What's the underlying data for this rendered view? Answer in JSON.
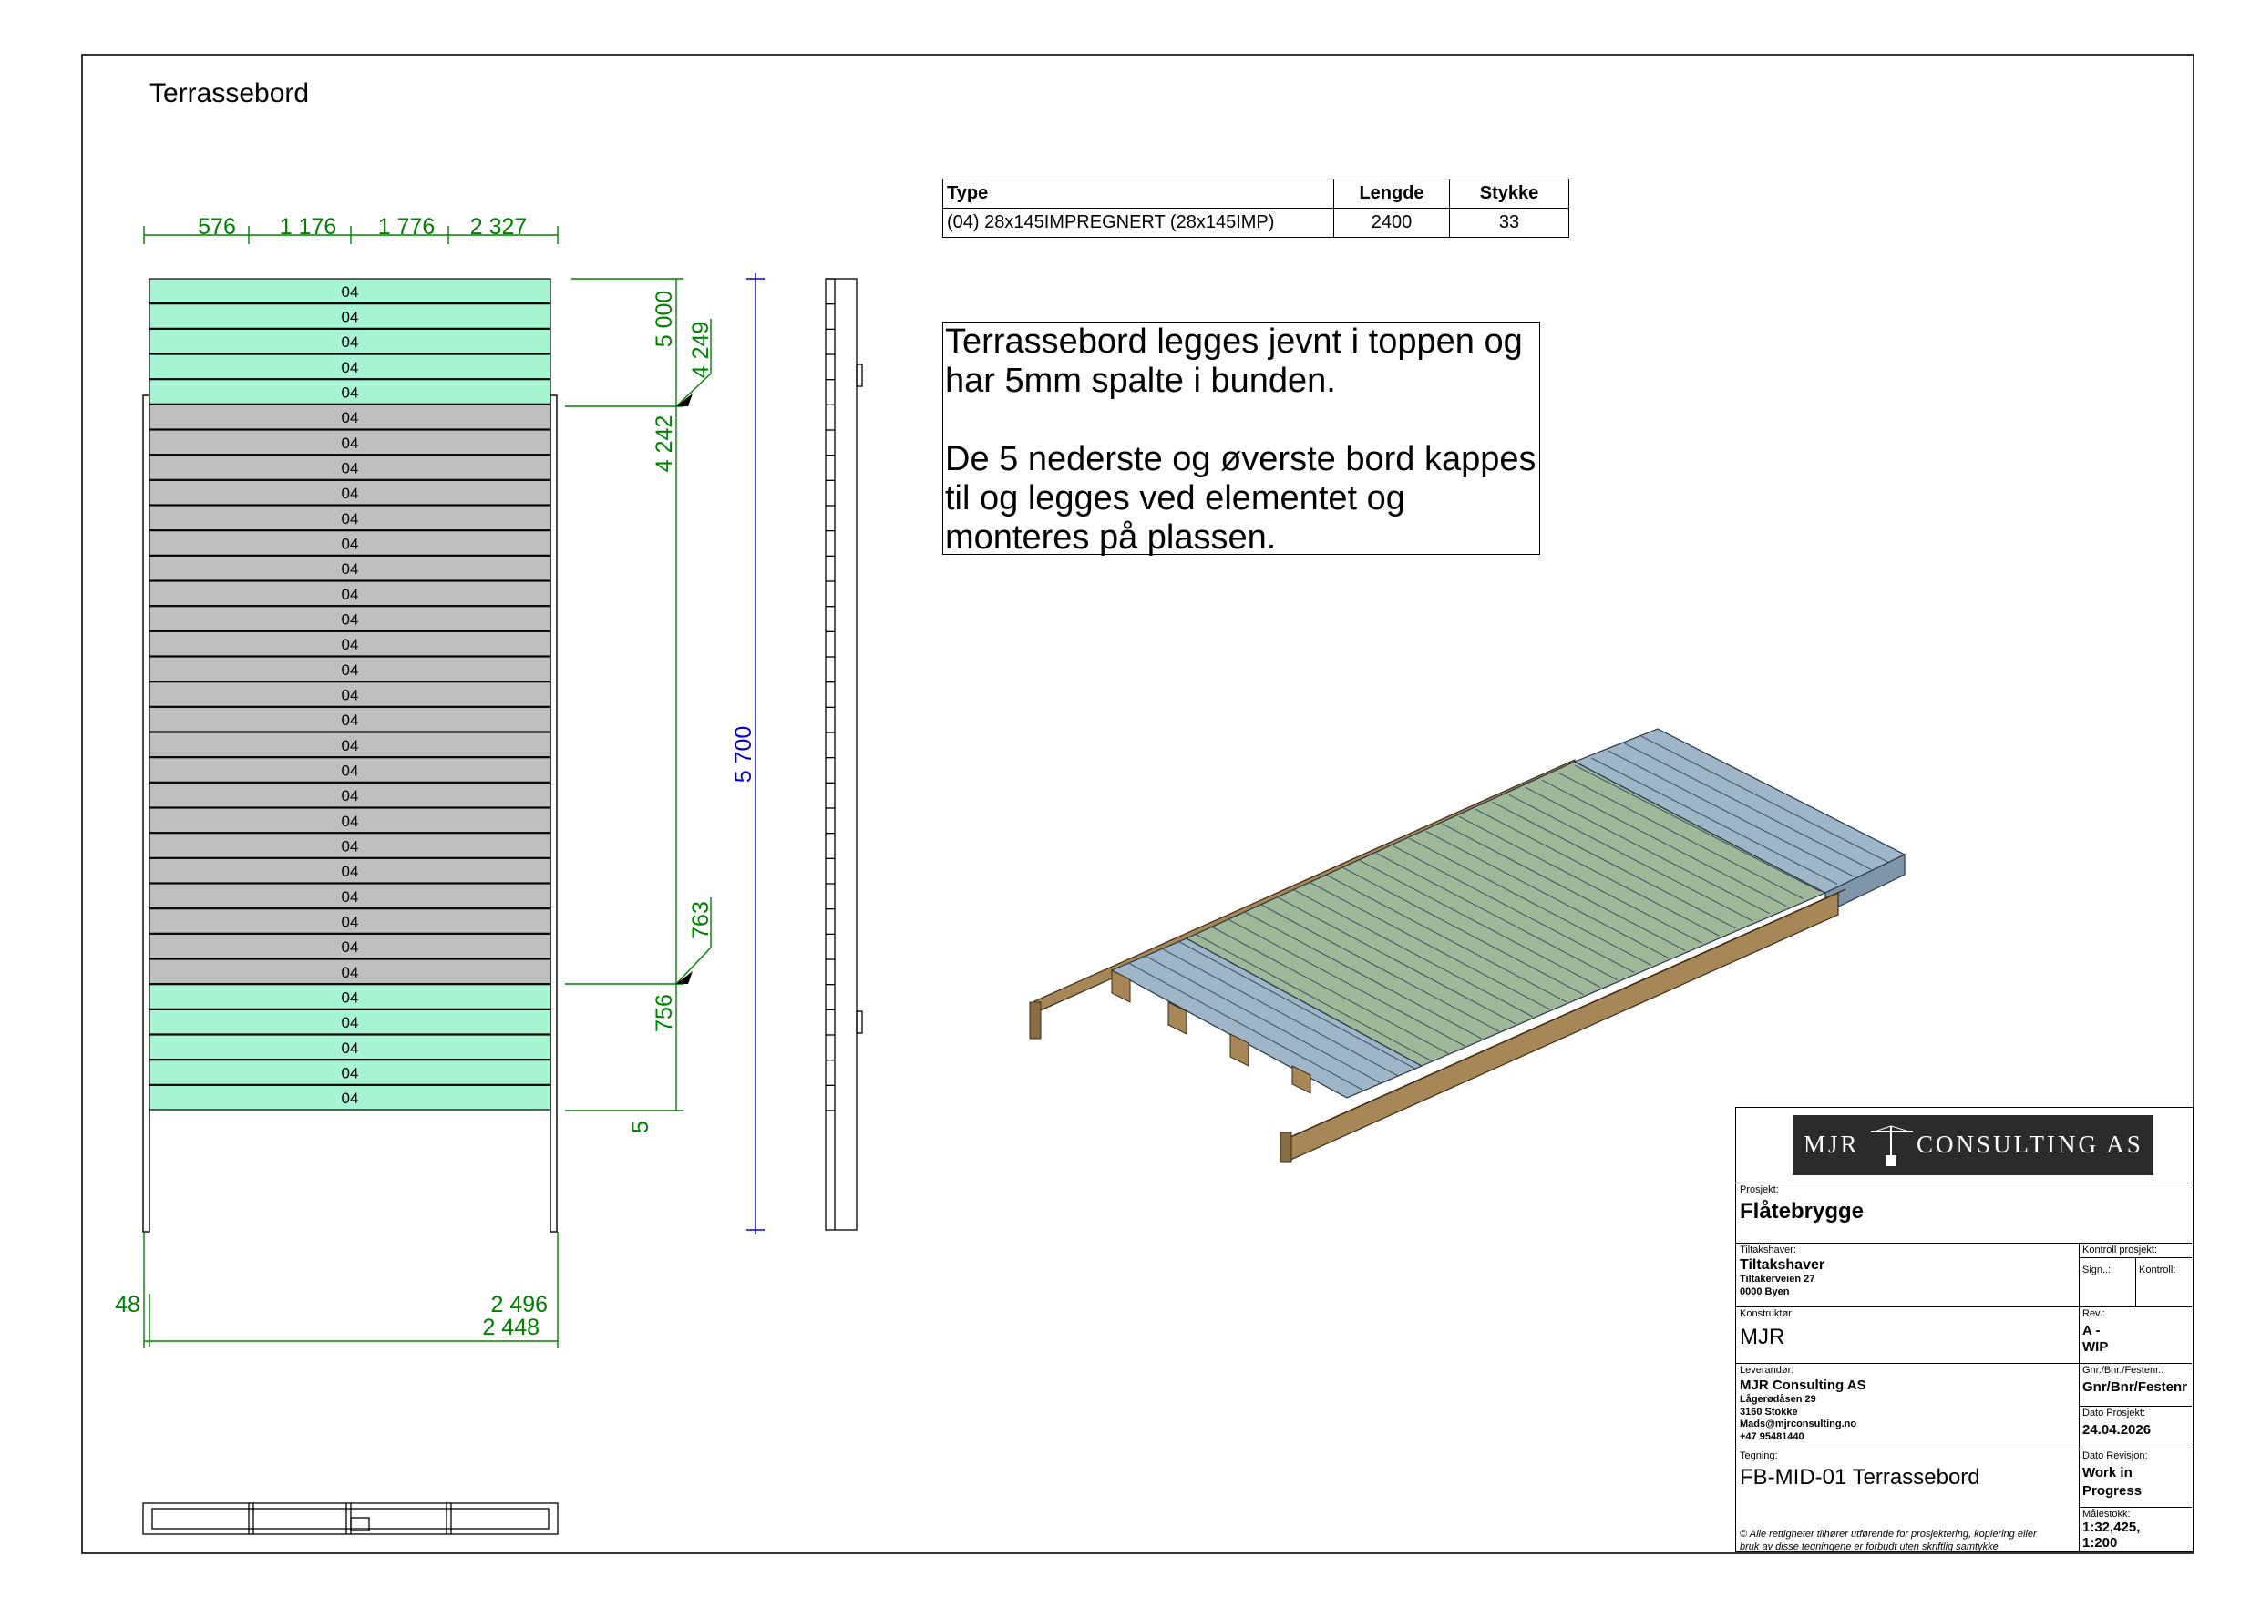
{
  "drawing": {
    "title": "Terrassebord",
    "board_label": "04",
    "board_count": 33,
    "board_types": [
      "accent",
      "accent",
      "accent",
      "accent",
      "accent",
      "main",
      "main",
      "main",
      "main",
      "main",
      "main",
      "main",
      "main",
      "main",
      "main",
      "main",
      "main",
      "main",
      "main",
      "main",
      "main",
      "main",
      "main",
      "main",
      "main",
      "main",
      "main",
      "main",
      "accent",
      "accent",
      "accent",
      "accent",
      "accent"
    ],
    "dims_top": [
      "576",
      "1 176",
      "1 776",
      "2 327"
    ],
    "dims_right_green": [
      "5 000",
      "4 249",
      "4 242",
      "763",
      "756",
      "5"
    ],
    "dim_total": "5 700",
    "dims_bottom": [
      "48",
      "2 496",
      "2 448"
    ],
    "colors": {
      "accent": "#a8f5d3",
      "main": "#bfbfbf",
      "dim": "#008000",
      "dim_total": "#0000cc",
      "iso_blue": "#9fb6c8",
      "iso_green": "#9fb89a",
      "iso_wood": "#a78658"
    }
  },
  "parts_table": {
    "headers": {
      "type": "Type",
      "length": "Lengde",
      "qty": "Stykke"
    },
    "rows": [
      {
        "type": "(04) 28x145IMPREGNERT (28x145IMP)",
        "length": "2400",
        "qty": "33"
      }
    ]
  },
  "note": {
    "p1": "Terrassebord legges jevnt i toppen og har 5mm spalte i bunden.",
    "p2": "De 5 nederste og øverste bord kappes til og legges ved elementet og monteres på plassen."
  },
  "title_block": {
    "logo_left": "MJR",
    "logo_right": "CONSULTING AS",
    "prosjekt_label": "Prosjekt:",
    "prosjekt": "Flåtebrygge",
    "tiltakshaver_label": "Tiltakshaver:",
    "tiltakshaver_name": "Tiltakshaver",
    "tiltakshaver_addr1": "Tiltakerveien 27",
    "tiltakshaver_addr2": "0000 Byen",
    "kontroll_label": "Kontroll prosjekt:",
    "sign_label": "Sign..:",
    "kontroll_short": "Kontroll:",
    "konstruktor_label": "Konstruktør:",
    "konstruktor": "MJR",
    "rev_label": "Rev.:",
    "rev_line1": "A -",
    "rev_line2": "WIP",
    "leverandor_label": "Leverandør:",
    "leverandor_name": "MJR Consulting AS",
    "leverandor_l1": "Lågerødåsen 29",
    "leverandor_l2": "3160 Stokke",
    "leverandor_l3": "Mads@mjrconsulting.no",
    "leverandor_l4": "+47 95481440",
    "gnr_label": "Gnr./Bnr./Festenr.:",
    "gnr": "Gnr/Bnr/Festenr",
    "dato_prosjekt_label": "Dato Prosjekt:",
    "dato_prosjekt": "24.04.2026",
    "tegning_label": "Tegning:",
    "tegning": "FB-MID-01 Terrassebord",
    "dato_revisjon_label": "Dato Revisjon:",
    "dato_revisjon_l1": "Work in",
    "dato_revisjon_l2": "Progress",
    "malestokk_label": "Målestokk:",
    "malestokk_l1": "1:32,425,",
    "malestokk_l2": "1:200",
    "copyright_l1": "© Alle rettigheter tilhører utførende for prosjektering, kopiering eller",
    "copyright_l2": "bruk av disse tegningene er forbudt uten skriftlig samtykke"
  }
}
